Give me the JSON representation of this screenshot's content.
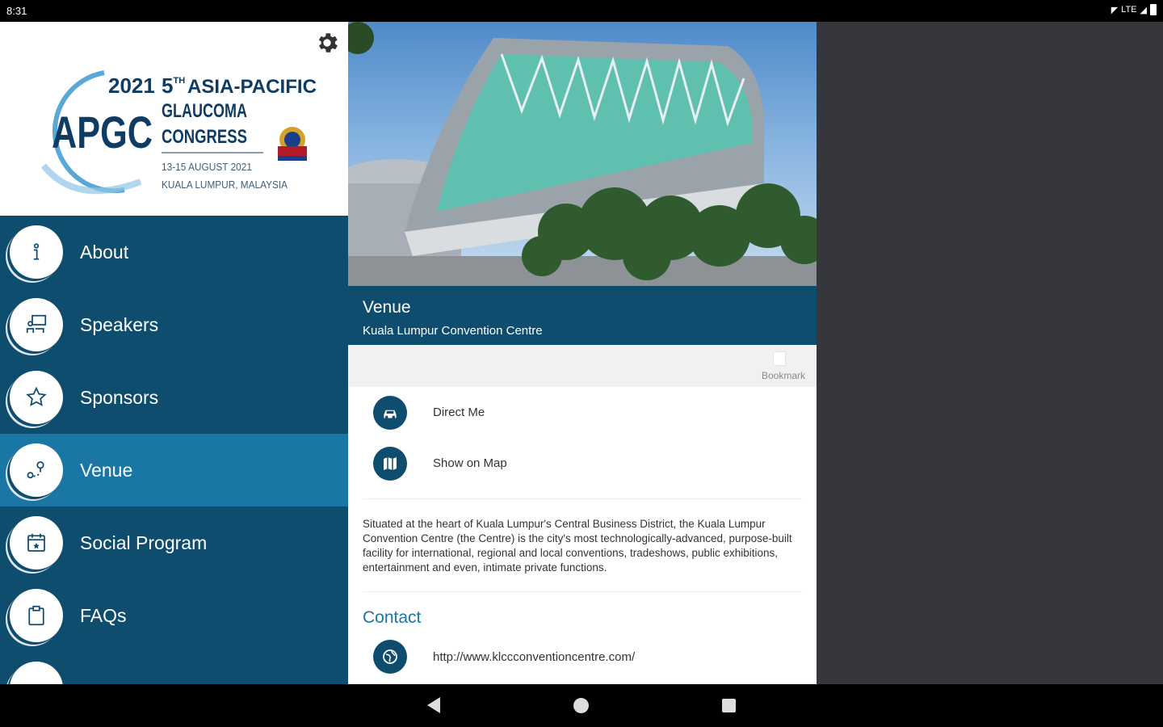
{
  "status": {
    "time": "8:31",
    "network": "LTE"
  },
  "logo": {
    "year": "2021",
    "acronym": "APGC",
    "edition": "5",
    "edition_sup": "TH",
    "line1": "ASIA-PACIFIC",
    "line2": "GLAUCOMA",
    "line3": "CONGRESS",
    "dates": "13-15 AUGUST 2021",
    "location": "KUALA LUMPUR, MALAYSIA"
  },
  "menu": [
    {
      "label": "About",
      "icon": "info-icon",
      "active": false
    },
    {
      "label": "Speakers",
      "icon": "speaker-icon",
      "active": false
    },
    {
      "label": "Sponsors",
      "icon": "star-icon",
      "active": false
    },
    {
      "label": "Venue",
      "icon": "map-pin-icon",
      "active": true
    },
    {
      "label": "Social Program",
      "icon": "calendar-icon",
      "active": false
    },
    {
      "label": "FAQs",
      "icon": "clipboard-icon",
      "active": false
    }
  ],
  "venue": {
    "title": "Venue",
    "subtitle": "Kuala Lumpur Convention Centre",
    "bookmark_label": "Bookmark",
    "actions": [
      {
        "label": "Direct Me",
        "icon": "car-icon"
      },
      {
        "label": "Show on Map",
        "icon": "map-icon"
      }
    ],
    "description": "Situated at the heart of Kuala Lumpur's Central Business District, the Kuala Lumpur Convention Centre (the Centre) is the city's most technologically-advanced, purpose-built facility for international, regional and local conventions, tradeshows, public exhibitions, entertainment and even, intimate private functions.",
    "contact_heading": "Contact",
    "website": "http://www.klccconventioncentre.com/"
  },
  "colors": {
    "primary": "#0f4d6e",
    "active": "#1a76a4",
    "right_panel": "#36373d"
  }
}
